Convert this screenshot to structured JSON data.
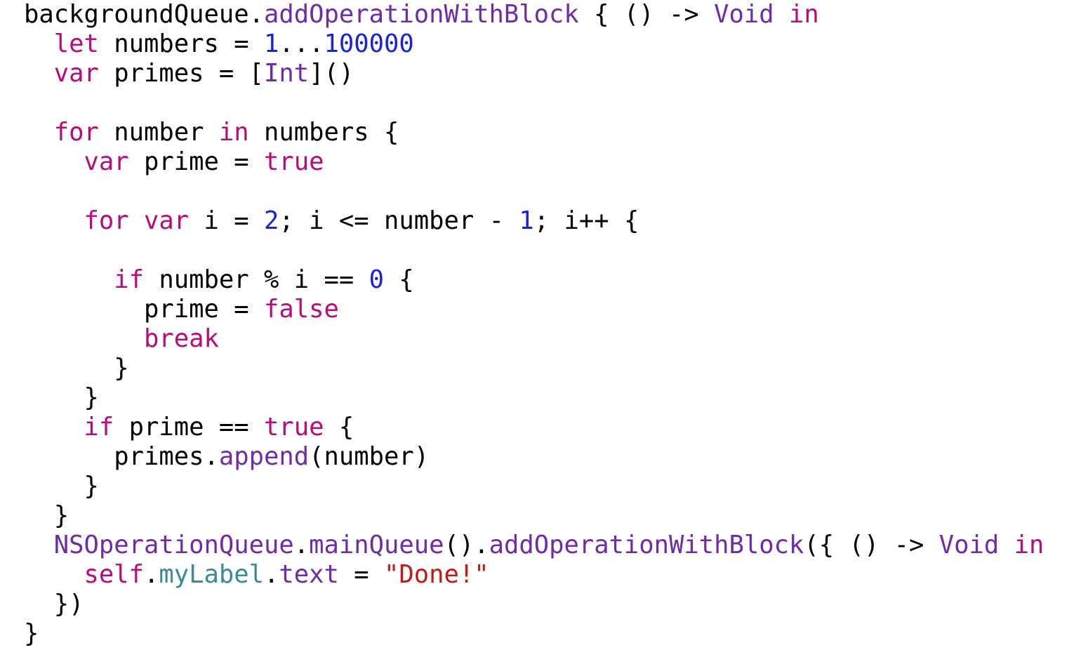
{
  "editor": {
    "colors": {
      "keyword": "#b80c7a",
      "type": "#6f2ba8",
      "method": "#6f2ba8",
      "number": "#1c21e0",
      "string": "#c41a16",
      "property": "#3a8a99",
      "plain": "#000000",
      "background": "#ffffff"
    },
    "lines": [
      [
        [
          "plain",
          "backgroundQueue."
        ],
        [
          "method",
          "addOperationWithBlock"
        ],
        [
          "plain",
          " { () -> "
        ],
        [
          "type",
          "Void"
        ],
        [
          "plain",
          " "
        ],
        [
          "keyword",
          "in"
        ]
      ],
      [
        [
          "plain",
          "  "
        ],
        [
          "keyword",
          "let"
        ],
        [
          "plain",
          " numbers = "
        ],
        [
          "number",
          "1"
        ],
        [
          "plain",
          "..."
        ],
        [
          "number",
          "100000"
        ]
      ],
      [
        [
          "plain",
          "  "
        ],
        [
          "keyword",
          "var"
        ],
        [
          "plain",
          " primes = ["
        ],
        [
          "type",
          "Int"
        ],
        [
          "plain",
          "]()"
        ]
      ],
      [],
      [
        [
          "plain",
          "  "
        ],
        [
          "keyword",
          "for"
        ],
        [
          "plain",
          " number "
        ],
        [
          "keyword",
          "in"
        ],
        [
          "plain",
          " numbers {"
        ]
      ],
      [
        [
          "plain",
          "    "
        ],
        [
          "keyword",
          "var"
        ],
        [
          "plain",
          " prime = "
        ],
        [
          "keyword",
          "true"
        ]
      ],
      [],
      [
        [
          "plain",
          "    "
        ],
        [
          "keyword",
          "for"
        ],
        [
          "plain",
          " "
        ],
        [
          "keyword",
          "var"
        ],
        [
          "plain",
          " i = "
        ],
        [
          "number",
          "2"
        ],
        [
          "plain",
          "; i <= number - "
        ],
        [
          "number",
          "1"
        ],
        [
          "plain",
          "; i++ {"
        ]
      ],
      [],
      [
        [
          "plain",
          "      "
        ],
        [
          "keyword",
          "if"
        ],
        [
          "plain",
          " number % i == "
        ],
        [
          "number",
          "0"
        ],
        [
          "plain",
          " {"
        ]
      ],
      [
        [
          "plain",
          "        prime = "
        ],
        [
          "keyword",
          "false"
        ]
      ],
      [
        [
          "plain",
          "        "
        ],
        [
          "keyword",
          "break"
        ]
      ],
      [
        [
          "plain",
          "      }"
        ]
      ],
      [
        [
          "plain",
          "    }"
        ]
      ],
      [
        [
          "plain",
          "    "
        ],
        [
          "keyword",
          "if"
        ],
        [
          "plain",
          " prime == "
        ],
        [
          "keyword",
          "true"
        ],
        [
          "plain",
          " {"
        ]
      ],
      [
        [
          "plain",
          "      primes."
        ],
        [
          "method",
          "append"
        ],
        [
          "plain",
          "(number)"
        ]
      ],
      [
        [
          "plain",
          "    }"
        ]
      ],
      [
        [
          "plain",
          "  }"
        ]
      ],
      [
        [
          "plain",
          "  "
        ],
        [
          "type",
          "NSOperationQueue"
        ],
        [
          "plain",
          "."
        ],
        [
          "method",
          "mainQueue"
        ],
        [
          "plain",
          "()."
        ],
        [
          "method",
          "addOperationWithBlock"
        ],
        [
          "plain",
          "({ () -> "
        ],
        [
          "type",
          "Void"
        ],
        [
          "plain",
          " "
        ],
        [
          "keyword",
          "in"
        ]
      ],
      [
        [
          "plain",
          "    "
        ],
        [
          "keyword",
          "self"
        ],
        [
          "plain",
          "."
        ],
        [
          "prop",
          "myLabel"
        ],
        [
          "plain",
          "."
        ],
        [
          "method",
          "text"
        ],
        [
          "plain",
          " = "
        ],
        [
          "string",
          "\"Done!\""
        ]
      ],
      [
        [
          "plain",
          "  })"
        ]
      ],
      [
        [
          "plain",
          "}"
        ]
      ]
    ]
  }
}
